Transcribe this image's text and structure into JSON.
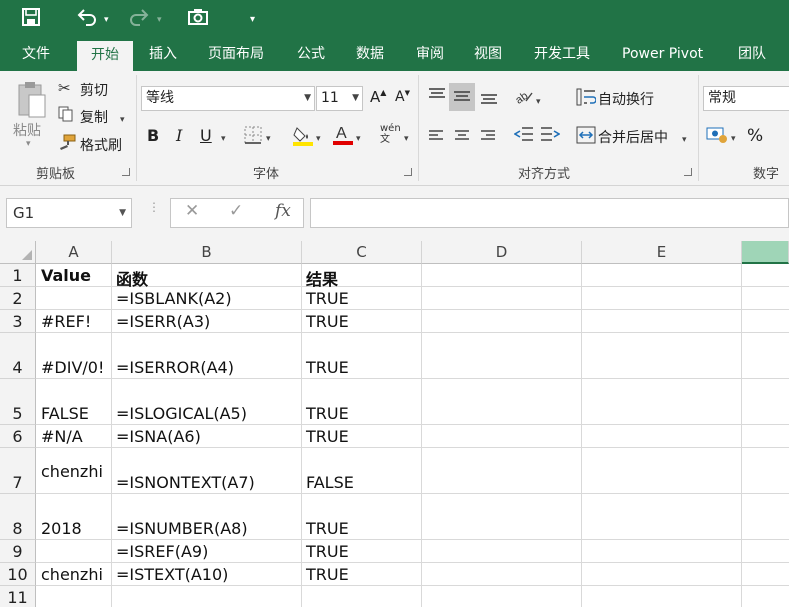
{
  "quick_access": {
    "customize_caret": "▾"
  },
  "tabs": [
    {
      "label": "文件"
    },
    {
      "label": "开始"
    },
    {
      "label": "插入"
    },
    {
      "label": "页面布局"
    },
    {
      "label": "公式"
    },
    {
      "label": "数据"
    },
    {
      "label": "审阅"
    },
    {
      "label": "视图"
    },
    {
      "label": "开发工具"
    },
    {
      "label": "Power Pivot"
    },
    {
      "label": "团队"
    }
  ],
  "clipboard": {
    "paste_label": "粘贴",
    "cut_label": "剪切",
    "copy_label": "复制",
    "format_painter_label": "格式刷",
    "group_label": "剪贴板"
  },
  "font": {
    "font_name": "等线",
    "font_size": "11",
    "bold": "B",
    "italic": "I",
    "underline": "U",
    "group_label": "字体"
  },
  "alignment": {
    "wrap_text_label": "自动换行",
    "merge_center_label": "合并后居中",
    "group_label": "对齐方式"
  },
  "number": {
    "format_value": "常规",
    "percent": "%",
    "group_label": "数字"
  },
  "formula_bar": {
    "name_box": "G1",
    "fx": "fx",
    "cancel": "✕",
    "enter": "✓",
    "formula": ""
  },
  "sheet": {
    "columns": [
      "A",
      "B",
      "C",
      "D",
      "E"
    ],
    "rows": [
      "1",
      "2",
      "3",
      "4",
      "5",
      "6",
      "7",
      "8",
      "9",
      "10",
      "11"
    ],
    "cells": {
      "r1": {
        "a": "Value",
        "b": "函数",
        "c": "结果"
      },
      "r2": {
        "a": "",
        "b": "=ISBLANK(A2)",
        "c": "TRUE"
      },
      "r3": {
        "a": "#REF!",
        "b": "=ISERR(A3)",
        "c": "TRUE"
      },
      "r4": {
        "a": "#DIV/0!",
        "b": "=ISERROR(A4)",
        "c": "TRUE"
      },
      "r5": {
        "a": "FALSE",
        "b": "=ISLOGICAL(A5)",
        "c": "TRUE"
      },
      "r6": {
        "a": "#N/A",
        "b": "=ISNA(A6)",
        "c": "TRUE"
      },
      "r7": {
        "a": "chenzhi",
        "b": "=ISNONTEXT(A7)",
        "c": "FALSE"
      },
      "r8": {
        "a": "2018",
        "b": "=ISNUMBER(A8)",
        "c": "TRUE"
      },
      "r9": {
        "a": "",
        "b": "=ISREF(A9)",
        "c": "TRUE"
      },
      "r10": {
        "a": "chenzhi",
        "b": "=ISTEXT(A10)",
        "c": "TRUE"
      }
    }
  },
  "colors": {
    "accent": "#217346",
    "selected_col": "#9fd5b7"
  }
}
